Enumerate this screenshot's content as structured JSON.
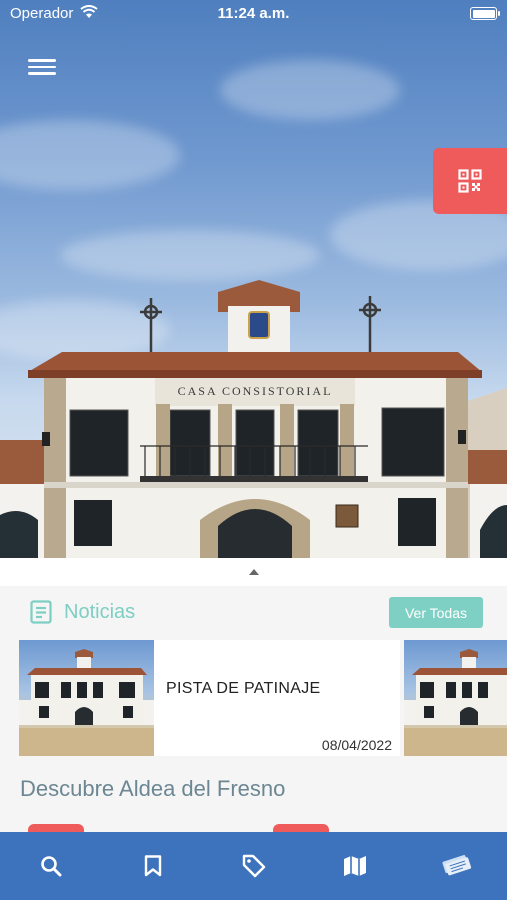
{
  "status_bar": {
    "carrier": "Operador",
    "time": "11:24 a.m."
  },
  "hero": {
    "building_sign": "CASA CONSISTORIAL",
    "menu_icon": "hamburger-menu-icon",
    "qr_icon": "qr-code-icon",
    "collapse_icon": "caret-up-icon"
  },
  "news": {
    "section_title": "Noticias",
    "see_all_label": "Ver Todas",
    "items": [
      {
        "title": "PISTA DE PATINAJE",
        "date": "08/04/2022"
      }
    ]
  },
  "discover": {
    "title": "Descubre Aldea del Fresno"
  },
  "tabbar": {
    "tabs": [
      {
        "icon": "search-icon"
      },
      {
        "icon": "bookmark-icon"
      },
      {
        "icon": "tag-icon"
      },
      {
        "icon": "map-icon"
      },
      {
        "icon": "tickets-icon"
      }
    ]
  },
  "colors": {
    "accent_teal": "#7fd0c4",
    "accent_red": "#ef5b5b",
    "tabbar_blue": "#3d73bd"
  }
}
